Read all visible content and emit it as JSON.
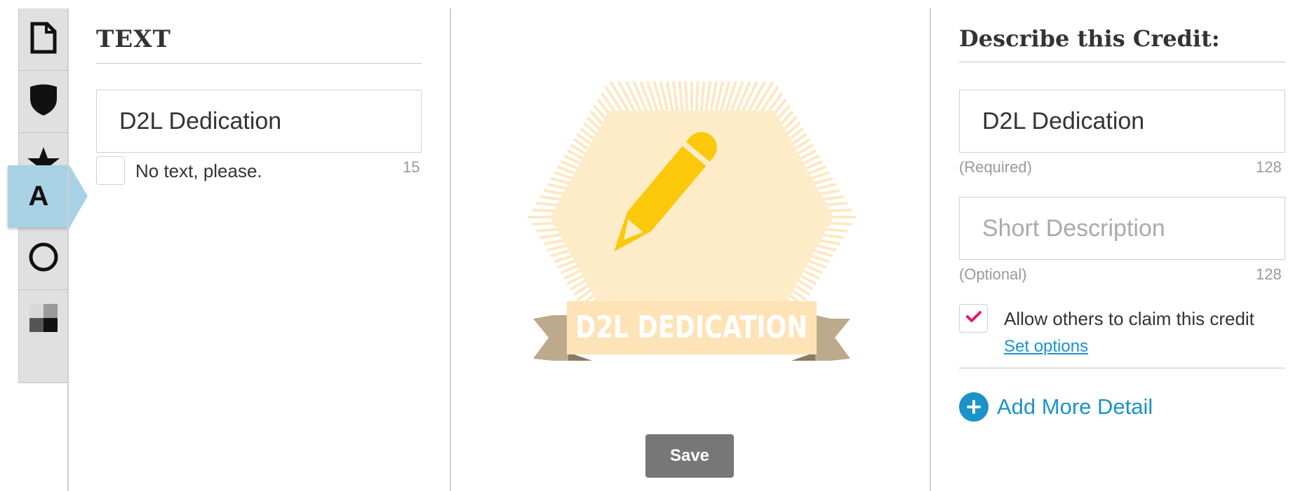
{
  "tools": [
    {
      "name": "page-tool",
      "icon": "page-icon",
      "active": false
    },
    {
      "name": "shield-tool",
      "icon": "shield-icon",
      "active": false
    },
    {
      "name": "star-tool",
      "icon": "star-icon",
      "active": false
    },
    {
      "name": "text-tool",
      "icon": "letter-a-icon",
      "label": "A",
      "active": true
    },
    {
      "name": "circle-tool",
      "icon": "circle-icon",
      "active": false
    },
    {
      "name": "texture-tool",
      "icon": "checker-icon",
      "active": false
    }
  ],
  "text_panel": {
    "heading": "TEXT",
    "text_value": "D2L Dedication",
    "no_text_label": "No text, please.",
    "char_count": "15"
  },
  "badge": {
    "label": "D2L DEDICATION",
    "colors": {
      "rays": "#fde8c4",
      "hexagon": "#feecc9",
      "pencil": "#fbc80a",
      "ribbon": "#fee3b6",
      "ribbon_tail": "#bda98c"
    }
  },
  "save_label": "Save",
  "credit_panel": {
    "heading": "Describe this Credit",
    "heading_colon": ":",
    "name_value": "D2L Dedication",
    "name_hint": "(Required)",
    "name_limit": "128",
    "description_placeholder": "Short Description",
    "description_hint": "(Optional)",
    "description_limit": "128",
    "allow_claim_label": "Allow others to claim this credit",
    "allow_claim_checked": true,
    "set_options_label": "Set options",
    "add_more_label": "Add More Detail"
  },
  "colors": {
    "accent": "#1a93c9",
    "active_tool": "#a9d1e4",
    "check": "#e6196b",
    "save_button": "#777777"
  }
}
